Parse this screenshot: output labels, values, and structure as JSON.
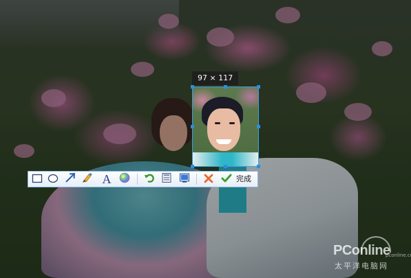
{
  "selection": {
    "size_label": "97 × 117"
  },
  "toolbar": {
    "tools": [
      {
        "icon": "rectangle-icon"
      },
      {
        "icon": "ellipse-icon"
      },
      {
        "icon": "arrow-icon"
      },
      {
        "icon": "brush-icon"
      },
      {
        "icon": "text-icon",
        "glyph": "A"
      },
      {
        "icon": "color-picker-icon"
      },
      {
        "icon": "undo-icon"
      },
      {
        "icon": "save-icon"
      },
      {
        "icon": "copy-to-clipboard-icon"
      },
      {
        "icon": "cancel-icon"
      },
      {
        "icon": "confirm-icon"
      }
    ],
    "done_label": "完成"
  },
  "watermark": {
    "brand": "PConline",
    "subtitle": "太平洋电脑网",
    "url": "pconline.com.cn"
  },
  "colors": {
    "selection_border": "#3b9fe6",
    "handle": "#2a8ee3",
    "toolbar_border": "#8fb4e0",
    "cancel": "#e8692c",
    "confirm": "#3aa52a"
  }
}
